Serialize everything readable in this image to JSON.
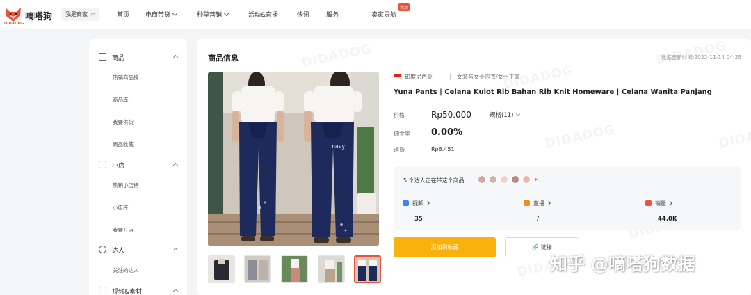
{
  "colors": {
    "accent": "#f9b10d",
    "brand": "#e8533a"
  },
  "brand": {
    "name": "嘀嗒狗",
    "sub": "DIDADOG",
    "logo_icon": "fox-logo-icon"
  },
  "header": {
    "role_switch": "我是商家",
    "nav": [
      {
        "label": "首页"
      },
      {
        "label": "电商带货"
      },
      {
        "label": "种草营销"
      },
      {
        "label": "活动&直播"
      },
      {
        "label": "快讯"
      },
      {
        "label": "服务"
      },
      {
        "label": "卖家导航"
      }
    ],
    "new_badge": "常用"
  },
  "sidebar": {
    "groups": [
      {
        "label": "商品",
        "icon": "bag-icon",
        "items": [
          "热销商品榜",
          "商品库",
          "我要供货",
          "商品收藏"
        ]
      },
      {
        "label": "小店",
        "icon": "store-icon",
        "items": [
          "热销小店榜",
          "小店库",
          "我要开店"
        ]
      },
      {
        "label": "达人",
        "icon": "person-icon",
        "items": [
          "关注的达人"
        ]
      },
      {
        "label": "视频&素材",
        "icon": "video-icon",
        "items": []
      }
    ]
  },
  "product": {
    "section_title": "商品信息",
    "update_time": "数据更新时间:2022-11-14 04:35",
    "watermark": "DIDADOG",
    "region": "印度尼西亚",
    "category": "女装与女士内衣/女士下装",
    "title": "Yuna Pants | Celana Kulot Rib Bahan Rib Knit Homeware | Celana Wanita Panjang",
    "price_label": "价格",
    "price": "Rp50.000",
    "spec": "规格(11)",
    "commission_label": "佣金率",
    "commission": "0.00%",
    "shipping_label": "运费",
    "shipping": "Rp6.451",
    "creators_text": "5 个达人正在带这个商品",
    "creator_avatars": [
      "#d8a7a0",
      "#c9b7b0",
      "#f2d0c4",
      "#b78a84",
      "#e9b8a2"
    ],
    "stats": [
      {
        "label": "视频",
        "value": "35",
        "icon_color": "#3b82f6"
      },
      {
        "label": "直播",
        "value": "/",
        "icon_color": "#f28b20"
      },
      {
        "label": "销量",
        "value": "44.0K",
        "icon_color": "#e8533a"
      }
    ],
    "image_caption": "navy",
    "add_button": "添加到收藏",
    "link_button": "链接"
  },
  "credit": "知乎 @嘀嗒狗数据"
}
